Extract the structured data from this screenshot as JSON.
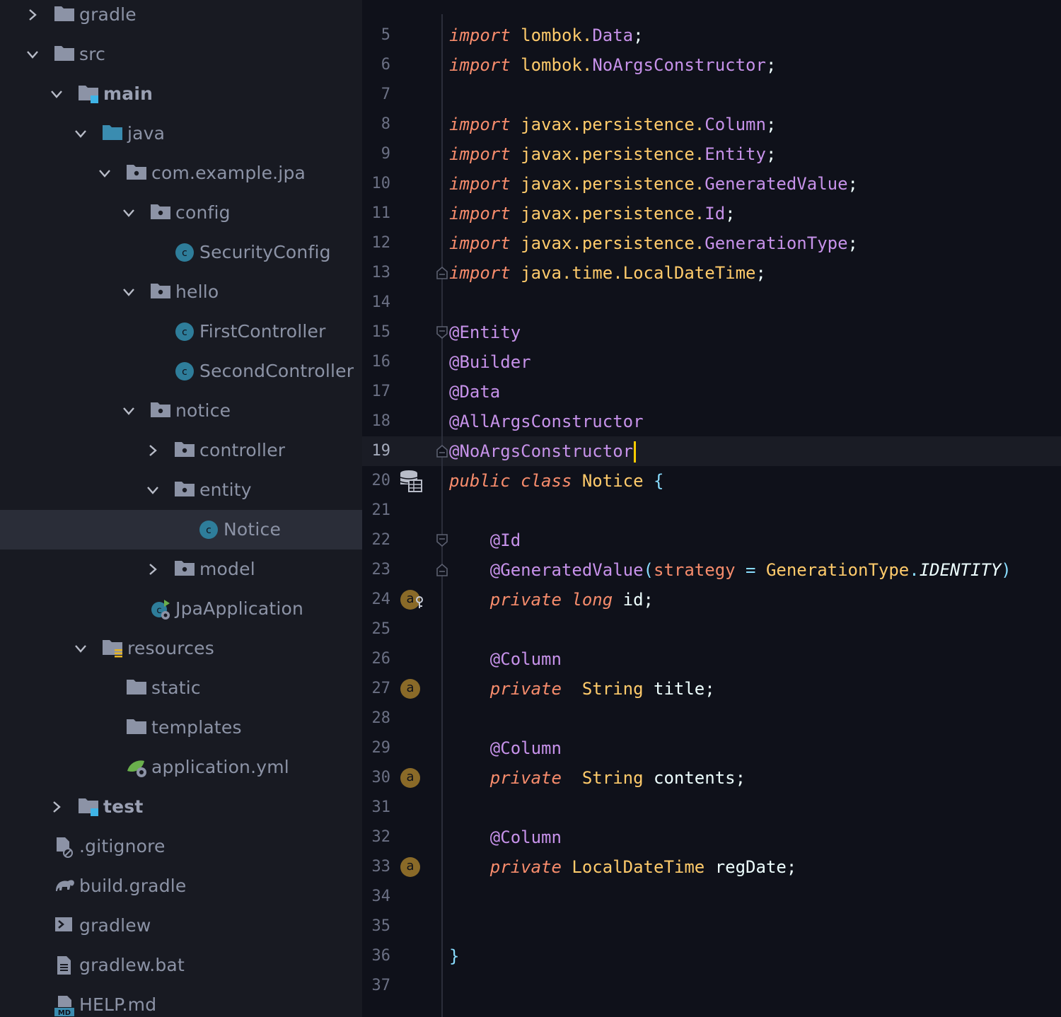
{
  "tree": [
    {
      "label": "gradle",
      "indent": 0,
      "chevron": "right",
      "icon": "folder-icon",
      "bold": false
    },
    {
      "label": "src",
      "indent": 0,
      "chevron": "down",
      "icon": "folder-icon",
      "bold": false
    },
    {
      "label": "main",
      "indent": 1,
      "chevron": "down",
      "icon": "source-root-folder-icon",
      "bold": true
    },
    {
      "label": "java",
      "indent": 2,
      "chevron": "down",
      "icon": "java-source-folder-icon",
      "bold": false
    },
    {
      "label": "com.example.jpa",
      "indent": 3,
      "chevron": "down",
      "icon": "package-icon",
      "bold": false
    },
    {
      "label": "config",
      "indent": 4,
      "chevron": "down",
      "icon": "package-icon",
      "bold": false
    },
    {
      "label": "SecurityConfig",
      "indent": 5,
      "chevron": "none",
      "icon": "class-icon",
      "bold": false
    },
    {
      "label": "hello",
      "indent": 4,
      "chevron": "down",
      "icon": "package-icon",
      "bold": false
    },
    {
      "label": "FirstController",
      "indent": 5,
      "chevron": "none",
      "icon": "class-icon",
      "bold": false
    },
    {
      "label": "SecondController",
      "indent": 5,
      "chevron": "none",
      "icon": "class-icon",
      "bold": false
    },
    {
      "label": "notice",
      "indent": 4,
      "chevron": "down",
      "icon": "package-icon",
      "bold": false
    },
    {
      "label": "controller",
      "indent": 5,
      "chevron": "right",
      "icon": "package-icon",
      "bold": false
    },
    {
      "label": "entity",
      "indent": 5,
      "chevron": "down",
      "icon": "package-icon",
      "bold": false
    },
    {
      "label": "Notice",
      "indent": 6,
      "chevron": "none",
      "icon": "class-icon",
      "bold": false,
      "selected": true
    },
    {
      "label": "model",
      "indent": 5,
      "chevron": "right",
      "icon": "package-icon",
      "bold": false
    },
    {
      "label": "JpaApplication",
      "indent": 4,
      "chevron": "none",
      "icon": "spring-app-icon",
      "bold": false
    },
    {
      "label": "resources",
      "indent": 2,
      "chevron": "down",
      "icon": "resources-folder-icon",
      "bold": false
    },
    {
      "label": "static",
      "indent": 3,
      "chevron": "none",
      "icon": "folder-icon",
      "bold": false
    },
    {
      "label": "templates",
      "indent": 3,
      "chevron": "none",
      "icon": "folder-icon",
      "bold": false
    },
    {
      "label": "application.yml",
      "indent": 3,
      "chevron": "none",
      "icon": "spring-config-icon",
      "bold": false
    },
    {
      "label": "test",
      "indent": 1,
      "chevron": "right",
      "icon": "source-root-folder-icon",
      "bold": true
    },
    {
      "label": ".gitignore",
      "indent": 0,
      "chevron": "none",
      "icon": "gitignore-file-icon",
      "bold": false
    },
    {
      "label": "build.gradle",
      "indent": 0,
      "chevron": "none",
      "icon": "gradle-elephant-icon",
      "bold": false
    },
    {
      "label": "gradlew",
      "indent": 0,
      "chevron": "none",
      "icon": "shell-script-icon",
      "bold": false
    },
    {
      "label": "gradlew.bat",
      "indent": 0,
      "chevron": "none",
      "icon": "text-file-icon",
      "bold": false
    },
    {
      "label": "HELP.md",
      "indent": 0,
      "chevron": "none",
      "icon": "markdown-file-icon",
      "bold": false
    }
  ],
  "editor": {
    "current_line": 19,
    "lines": [
      {
        "n": "5",
        "tokens": [
          [
            "kw",
            "import"
          ],
          [
            "pl",
            " "
          ],
          [
            "pk",
            "lombok."
          ],
          [
            "cl",
            "Data"
          ],
          [
            "pl",
            ";"
          ]
        ]
      },
      {
        "n": "6",
        "tokens": [
          [
            "kw",
            "import"
          ],
          [
            "pl",
            " "
          ],
          [
            "pk",
            "lombok."
          ],
          [
            "cl",
            "NoArgsConstructor"
          ],
          [
            "pl",
            ";"
          ]
        ]
      },
      {
        "n": "7",
        "tokens": []
      },
      {
        "n": "8",
        "tokens": [
          [
            "kw",
            "import"
          ],
          [
            "pl",
            " "
          ],
          [
            "pk",
            "javax.persistence."
          ],
          [
            "cl",
            "Column"
          ],
          [
            "pl",
            ";"
          ]
        ]
      },
      {
        "n": "9",
        "tokens": [
          [
            "kw",
            "import"
          ],
          [
            "pl",
            " "
          ],
          [
            "pk",
            "javax.persistence."
          ],
          [
            "cl",
            "Entity"
          ],
          [
            "pl",
            ";"
          ]
        ]
      },
      {
        "n": "10",
        "tokens": [
          [
            "kw",
            "import"
          ],
          [
            "pl",
            " "
          ],
          [
            "pk",
            "javax.persistence."
          ],
          [
            "cl",
            "GeneratedValue"
          ],
          [
            "pl",
            ";"
          ]
        ]
      },
      {
        "n": "11",
        "tokens": [
          [
            "kw",
            "import"
          ],
          [
            "pl",
            " "
          ],
          [
            "pk",
            "javax.persistence."
          ],
          [
            "cl",
            "Id"
          ],
          [
            "pl",
            ";"
          ]
        ]
      },
      {
        "n": "12",
        "tokens": [
          [
            "kw",
            "import"
          ],
          [
            "pl",
            " "
          ],
          [
            "pk",
            "javax.persistence."
          ],
          [
            "cl",
            "GenerationType"
          ],
          [
            "pl",
            ";"
          ]
        ]
      },
      {
        "n": "13",
        "tokens": [
          [
            "kw",
            "import"
          ],
          [
            "pl",
            " "
          ],
          [
            "pk",
            "java.time."
          ],
          [
            "ty",
            "LocalDateTime"
          ],
          [
            "pl",
            ";"
          ]
        ],
        "fold": "end"
      },
      {
        "n": "14",
        "tokens": []
      },
      {
        "n": "15",
        "tokens": [
          [
            "an",
            "@Entity"
          ]
        ],
        "fold": "start"
      },
      {
        "n": "16",
        "tokens": [
          [
            "an",
            "@Builder"
          ]
        ]
      },
      {
        "n": "17",
        "tokens": [
          [
            "an",
            "@Data"
          ]
        ]
      },
      {
        "n": "18",
        "tokens": [
          [
            "an",
            "@AllArgsConstructor"
          ]
        ]
      },
      {
        "n": "19",
        "tokens": [
          [
            "an",
            "@NoArgsConstructor"
          ]
        ],
        "fold": "end",
        "caret": true
      },
      {
        "n": "20",
        "tokens": [
          [
            "kw",
            "public"
          ],
          [
            "pl",
            " "
          ],
          [
            "kw",
            "class"
          ],
          [
            "pl",
            " "
          ],
          [
            "ty",
            "Notice"
          ],
          [
            "pl",
            " "
          ],
          [
            "pn",
            "{"
          ]
        ],
        "gutter_icon": "database-table-icon"
      },
      {
        "n": "21",
        "tokens": []
      },
      {
        "n": "22",
        "tokens": [
          [
            "pl",
            "    "
          ],
          [
            "an",
            "@Id"
          ]
        ],
        "fold": "start"
      },
      {
        "n": "23",
        "tokens": [
          [
            "pl",
            "    "
          ],
          [
            "an",
            "@GeneratedValue"
          ],
          [
            "pn",
            "("
          ],
          [
            "kw-plain",
            "strategy"
          ],
          [
            "pl",
            " "
          ],
          [
            "pn",
            "="
          ],
          [
            "pl",
            " "
          ],
          [
            "ty",
            "GenerationType"
          ],
          [
            "pn",
            "."
          ],
          [
            "en",
            "IDENTITY"
          ],
          [
            "pn",
            ")"
          ]
        ],
        "fold": "end"
      },
      {
        "n": "24",
        "tokens": [
          [
            "pl",
            "    "
          ],
          [
            "kw",
            "private"
          ],
          [
            "pl",
            " "
          ],
          [
            "kw",
            "long"
          ],
          [
            "pl",
            " id;"
          ]
        ],
        "badge": "a",
        "badge_key": true
      },
      {
        "n": "25",
        "tokens": []
      },
      {
        "n": "26",
        "tokens": [
          [
            "pl",
            "    "
          ],
          [
            "an",
            "@Column"
          ]
        ]
      },
      {
        "n": "27",
        "tokens": [
          [
            "pl",
            "    "
          ],
          [
            "kw",
            "private"
          ],
          [
            "pl",
            "  "
          ],
          [
            "ty",
            "String"
          ],
          [
            "pl",
            " title;"
          ]
        ],
        "badge": "a"
      },
      {
        "n": "28",
        "tokens": []
      },
      {
        "n": "29",
        "tokens": [
          [
            "pl",
            "    "
          ],
          [
            "an",
            "@Column"
          ]
        ]
      },
      {
        "n": "30",
        "tokens": [
          [
            "pl",
            "    "
          ],
          [
            "kw",
            "private"
          ],
          [
            "pl",
            "  "
          ],
          [
            "ty",
            "String"
          ],
          [
            "pl",
            " contents;"
          ]
        ],
        "badge": "a"
      },
      {
        "n": "31",
        "tokens": []
      },
      {
        "n": "32",
        "tokens": [
          [
            "pl",
            "    "
          ],
          [
            "an",
            "@Column"
          ]
        ]
      },
      {
        "n": "33",
        "tokens": [
          [
            "pl",
            "    "
          ],
          [
            "kw",
            "private"
          ],
          [
            "pl",
            " "
          ],
          [
            "ty",
            "LocalDateTime"
          ],
          [
            "pl",
            " regDate;"
          ]
        ],
        "badge": "a"
      },
      {
        "n": "34",
        "tokens": []
      },
      {
        "n": "35",
        "tokens": []
      },
      {
        "n": "36",
        "tokens": [
          [
            "pn",
            "}"
          ]
        ]
      },
      {
        "n": "37",
        "tokens": []
      }
    ]
  },
  "colors": {
    "keyword": "#f78c6c",
    "annotation": "#c792ea",
    "type": "#ffcb6b",
    "punct": "#89ddff",
    "text": "#eeffff",
    "caret": "#ffcc00"
  }
}
